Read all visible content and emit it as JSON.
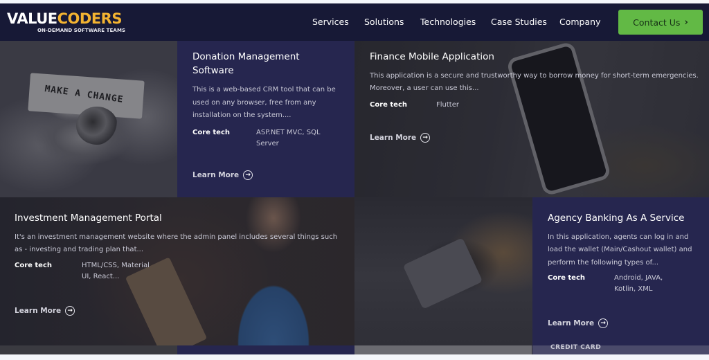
{
  "header": {
    "logo": {
      "part1": "VALUE",
      "part2": "CODERS",
      "tagline": "ON-DEMAND SOFTWARE TEAMS"
    },
    "nav": [
      {
        "label": "Services"
      },
      {
        "label": "Solutions"
      },
      {
        "label": "Technologies"
      },
      {
        "label": "Case Studies"
      },
      {
        "label": "Company"
      }
    ],
    "contact_label": "Contact Us",
    "contact_icon": "chevron-right-icon"
  },
  "colors": {
    "navbar_bg": "#171936",
    "card_bg": "#26264f",
    "accent_green": "#62b945",
    "logo_accent": "#f3b331"
  },
  "images": {
    "donation_note_text": "MAKE A CHANGE",
    "bottom_card_text": "CREDIT CARD"
  },
  "case_studies": [
    {
      "title": "Donation Management Software",
      "description": "This is a web-based CRM tool that can be used on any browser, free from any installation on the system....",
      "core_tech_label": "Core tech",
      "core_tech": "ASP.NET MVC, SQL Server",
      "learn_more": "Learn More"
    },
    {
      "title": "Finance Mobile Application",
      "description": "This application is a secure and trustworthy way to borrow money for short-term emergencies. Moreover, a user can use this...",
      "core_tech_label": "Core tech",
      "core_tech": "Flutter",
      "learn_more": "Learn More"
    },
    {
      "title": "Investment Management Portal",
      "description": "It's an investment management website where the admin panel includes several things such as - investing and trading plan that...",
      "core_tech_label": "Core tech",
      "core_tech": "HTML/CSS, Material UI, React...",
      "learn_more": "Learn More"
    },
    {
      "title": "Agency Banking As A Service",
      "description": "In this application, agents can log in and load the wallet (Main/Cashout wallet) and perform the following types of...",
      "core_tech_label": "Core tech",
      "core_tech": "Android, JAVA, Kotlin, XML",
      "learn_more": "Learn More"
    }
  ]
}
